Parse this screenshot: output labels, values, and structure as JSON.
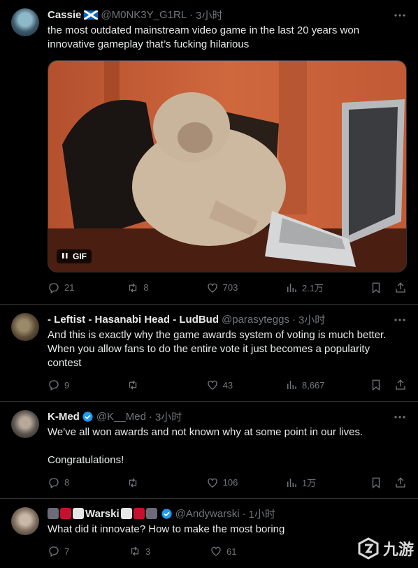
{
  "tweets": [
    {
      "name": "Cassie",
      "handle": "@M0NK3Y_G1RL",
      "separator": "·",
      "time": "3小时",
      "text": "the most outdated mainstream video game in the last 20 years won\ninnovative gameplay that’s fucking hilarious",
      "media": {
        "badge_label": "GIF"
      },
      "stats": {
        "replies": "21",
        "retweets": "8",
        "likes": "703",
        "views": "2.1万"
      }
    },
    {
      "name": "- Leftist - Hasanabi Head - LudBud",
      "handle": "@parasyteggs",
      "separator": "·",
      "time": "3小时",
      "text": "And this is exactly why the game awards system of voting is much better.\nWhen you allow fans to do the entire vote it just becomes a popularity\ncontest",
      "stats": {
        "replies": "9",
        "retweets": "",
        "likes": "43",
        "views": "8,667"
      }
    },
    {
      "name": "K-Med",
      "handle": "@K__Med",
      "separator": "·",
      "time": "3小时",
      "text": "We've all won awards and not known why at some point in our lives.\n\nCongratulations!",
      "stats": {
        "replies": "8",
        "retweets": "",
        "likes": "106",
        "views": "1万"
      }
    },
    {
      "name": "Warski",
      "handle": "@Andywarski",
      "separator": "·",
      "time": "1小时",
      "text": "What did it innovate? How to make the most boring",
      "stats": {
        "replies": "7",
        "retweets": "3",
        "likes": "61",
        "views": ""
      }
    }
  ],
  "watermark": {
    "text": "九游"
  },
  "colors": {
    "background": "#000000",
    "muted": "#71767b",
    "text": "#e7e9ea",
    "border": "#2f3336",
    "verified": "#1d9bf0"
  }
}
